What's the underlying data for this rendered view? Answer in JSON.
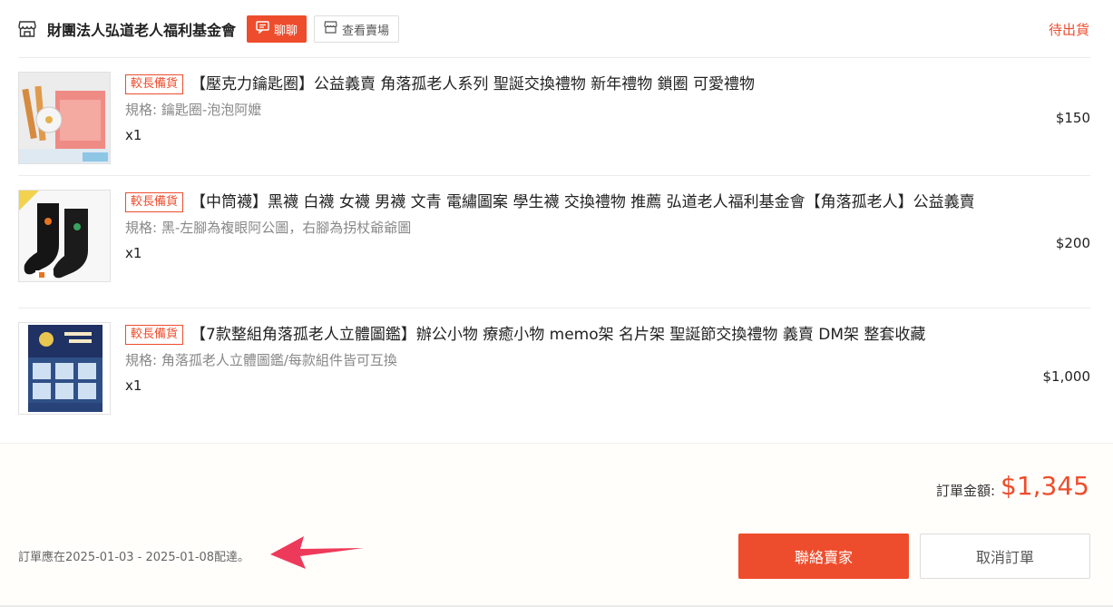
{
  "shop": {
    "name": "財團法人弘道老人福利基金會",
    "chat_label": "聊聊",
    "view_shop_label": "查看賣場",
    "status": "待出貨"
  },
  "items": [
    {
      "tag": "較長備貨",
      "title": "【壓克力鑰匙圈】公益義賣 角落孤老人系列 聖誕交換禮物 新年禮物 鎖圈 可愛禮物",
      "spec": "規格: 鑰匙圈-泡泡阿嬤",
      "qty": "x1",
      "price": "$150"
    },
    {
      "tag": "較長備貨",
      "title": "【中筒襪】黑襪 白襪 女襪 男襪 文青 電繡圖案 學生襪 交換禮物 推薦 弘道老人福利基金會【角落孤老人】公益義賣",
      "spec": "規格: 黑-左腳為複眼阿公圖，右腳為拐杖爺爺圖",
      "qty": "x1",
      "price": "$200"
    },
    {
      "tag": "較長備貨",
      "title": "【7款整組角落孤老人立體圖鑑】辦公小物 療癒小物 memo架 名片架 聖誕節交換禮物 義賣 DM架 整套收藏",
      "spec": "規格: 角落孤老人立體圖鑑/每款組件皆可互換",
      "qty": "x1",
      "price": "$1,000"
    }
  ],
  "footer": {
    "total_label": "訂單金額:",
    "total_value": "$1,345",
    "delivery_note": "訂單應在2025-01-03 - 2025-01-08配達。",
    "contact_label": "聯絡賣家",
    "cancel_label": "取消訂單"
  },
  "colors": {
    "accent": "#ee4d2d",
    "footer_bg": "#fffefb"
  },
  "icons": [
    "shop-icon",
    "chat-icon",
    "store-icon",
    "pointer-arrow"
  ]
}
